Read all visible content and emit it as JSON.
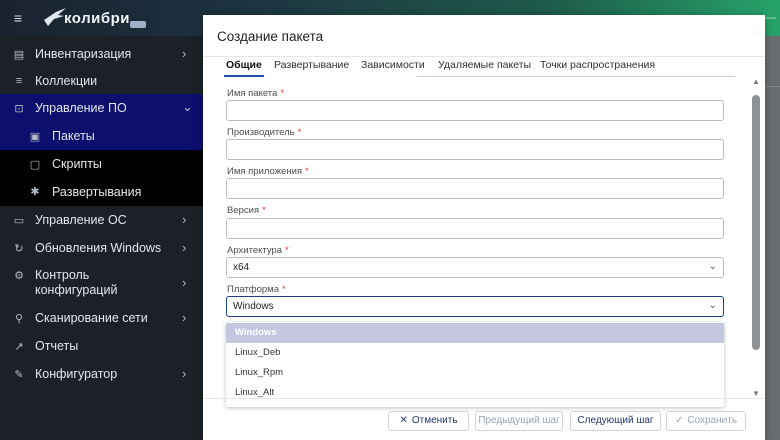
{
  "app": {
    "logo_text": "колибри",
    "topbar_right": "—"
  },
  "sidebar": {
    "items": [
      {
        "label": "Инвентаризация",
        "icon": "inventory-icon"
      },
      {
        "label": "Коллекции",
        "icon": "list-icon"
      },
      {
        "label": "Управление ПО",
        "icon": "software-icon"
      },
      {
        "label": "Управление ОС",
        "icon": "monitor-icon"
      },
      {
        "label": "Обновления Windows",
        "icon": "update-icon"
      },
      {
        "label": "Контроль",
        "label2": "конфигураций",
        "icon": "config-control-icon"
      },
      {
        "label": "Сканирование сети",
        "icon": "network-icon"
      },
      {
        "label": "Отчеты",
        "icon": "chart-icon"
      },
      {
        "label": "Конфигуратор",
        "icon": "wrench-icon"
      }
    ],
    "subitems": [
      {
        "label": "Пакеты",
        "icon": "package-icon"
      },
      {
        "label": "Скрипты",
        "icon": "script-icon"
      },
      {
        "label": "Развертывания",
        "icon": "deploy-icon"
      }
    ]
  },
  "modal": {
    "title": "Создание пакета",
    "tabs": [
      "Общие",
      "Развертывание",
      "Зависимости",
      "Удаляемые пакеты",
      "Точки распространения"
    ],
    "active_tab": "Общие",
    "fields": {
      "package_name": {
        "label": "Имя пакета",
        "value": ""
      },
      "vendor": {
        "label": "Производитель",
        "value": ""
      },
      "app_name": {
        "label": "Имя приложения",
        "value": ""
      },
      "version": {
        "label": "Версия",
        "value": ""
      },
      "architecture": {
        "label": "Архитектура",
        "value": "x64"
      },
      "platform": {
        "label": "Платформа",
        "value": "Windows"
      }
    },
    "platform_options": [
      "Windows",
      "Linux_Deb",
      "Linux_Rpm",
      "Linux_Alt"
    ],
    "buttons": {
      "cancel": "Отменить",
      "prev": "Предыдущий шаг",
      "next": "Следующий шаг",
      "save": "Сохранить"
    }
  },
  "colors": {
    "active_nav": "#0d0f6e",
    "accent": "#1f4ea8",
    "required": "#e53935",
    "selected_option": "#c5c6e0"
  }
}
